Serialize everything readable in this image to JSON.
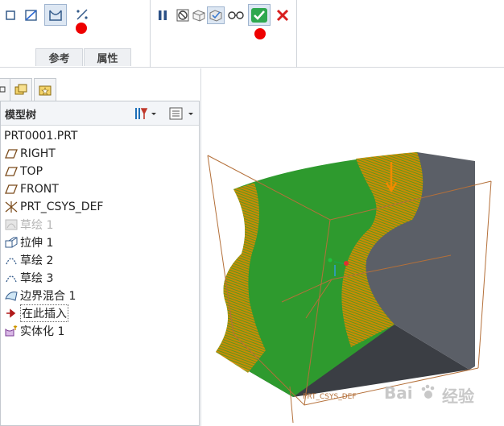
{
  "ribbon": {
    "tabs": [
      {
        "label": "参考"
      },
      {
        "label": "属性"
      }
    ],
    "tools": [
      {
        "name": "solid-icon"
      },
      {
        "name": "surface-icon"
      },
      {
        "name": "boundary-blend-icon",
        "active": true
      },
      {
        "name": "compound-curve-icon"
      }
    ],
    "control": [
      {
        "name": "pause-icon"
      },
      {
        "name": "no-preview-icon"
      },
      {
        "name": "check-model-icon"
      },
      {
        "name": "verify-icon"
      },
      {
        "name": "preview-glasses-icon"
      },
      {
        "name": "confirm-checkmark-icon"
      },
      {
        "name": "cancel-x-icon"
      }
    ],
    "marker_color": "#ee0000"
  },
  "panel": {
    "title": "模型树",
    "items": [
      {
        "label": "PRT0001.PRT",
        "icon": "part-icon",
        "dim": false
      },
      {
        "label": "RIGHT",
        "icon": "datum-plane-icon",
        "dim": false
      },
      {
        "label": "TOP",
        "icon": "datum-plane-icon",
        "dim": false
      },
      {
        "label": "FRONT",
        "icon": "datum-plane-icon",
        "dim": false
      },
      {
        "label": "PRT_CSYS_DEF",
        "icon": "csys-icon",
        "dim": false
      },
      {
        "label": "草绘 1",
        "icon": "sketch-icon",
        "dim": true
      },
      {
        "label": "拉伸 1",
        "icon": "extrude-icon",
        "dim": false
      },
      {
        "label": "草绘 2",
        "icon": "sketch-icon",
        "dim": false
      },
      {
        "label": "草绘 3",
        "icon": "sketch-icon",
        "dim": false
      },
      {
        "label": "边界混合 1",
        "icon": "boundary-blend-icon",
        "dim": false
      },
      {
        "label": "在此插入",
        "icon": "insert-arrow-icon",
        "dim": false,
        "insert": true
      },
      {
        "label": "实体化 1",
        "icon": "solidify-icon",
        "dim": false
      }
    ]
  },
  "viewport": {
    "csys_label": "PRT_CSYS_DEF",
    "colors": {
      "surface_green": "#2e9a2e",
      "highlight_orange": "#e08a00",
      "solid_face": "#5a5e66",
      "bottom_face": "#3a3d42",
      "datum_line": "#b4703a"
    }
  },
  "watermark": {
    "brand": "Bai",
    "suffix": "经验"
  }
}
